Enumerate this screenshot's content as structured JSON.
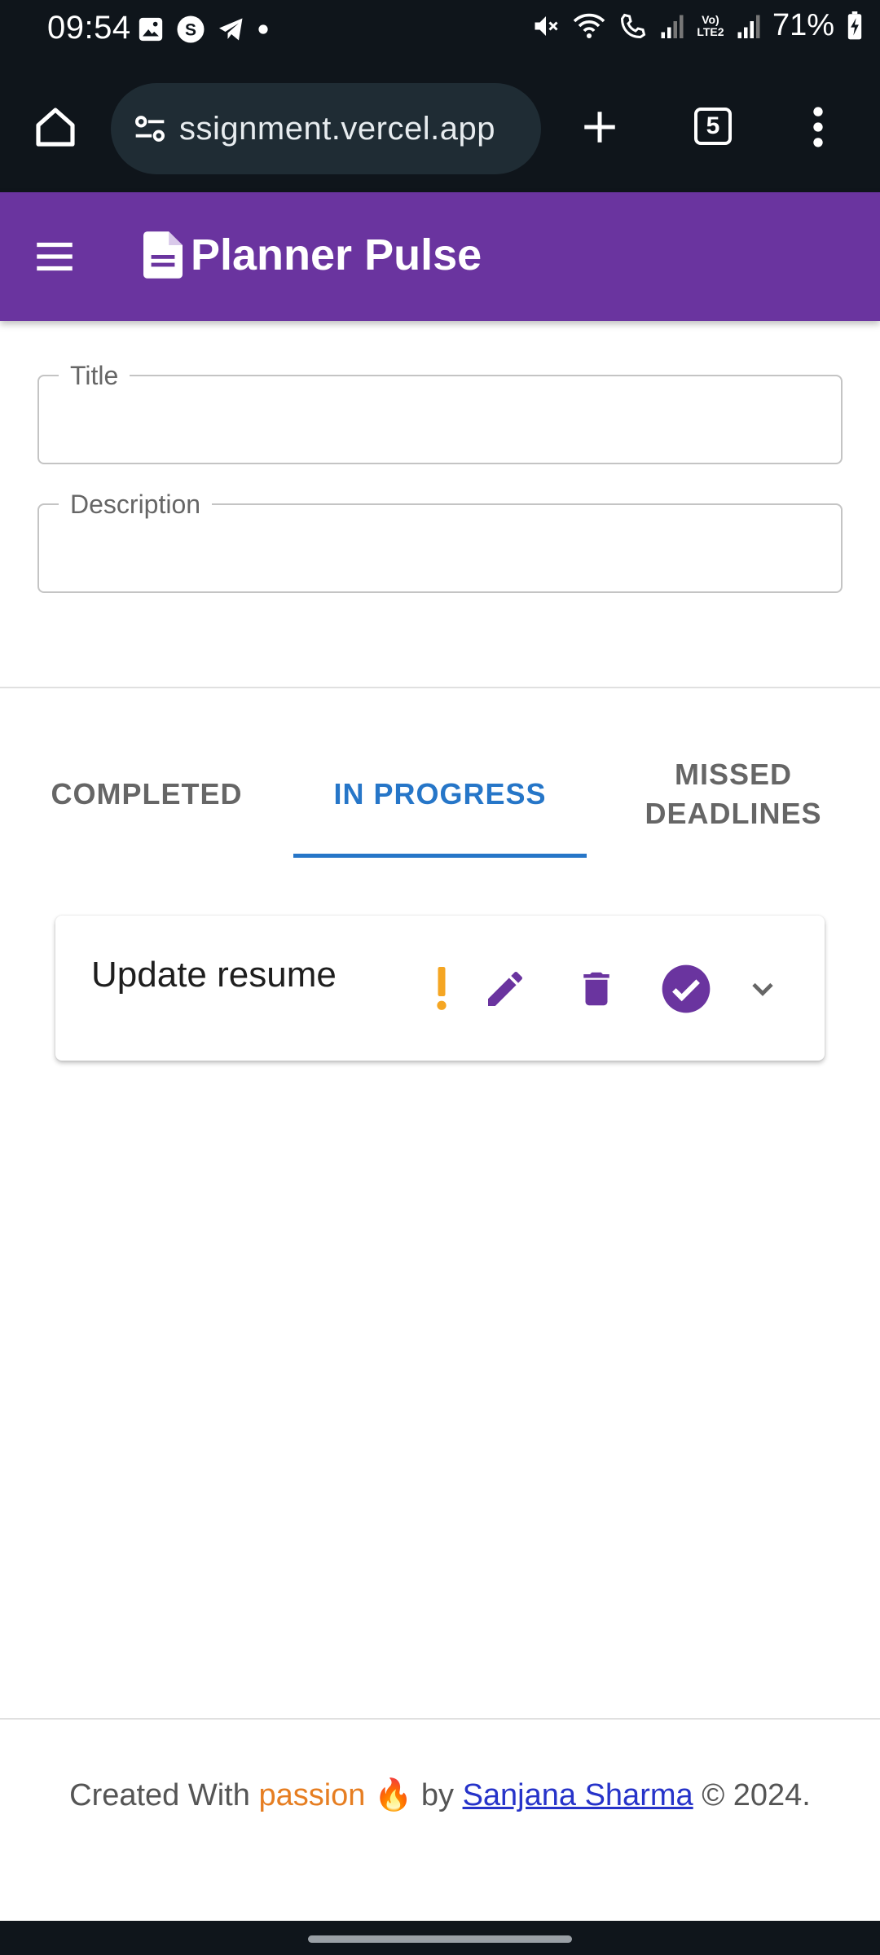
{
  "status_bar": {
    "time": "09:54",
    "battery": "71%",
    "network_label": "Vo) LTE2"
  },
  "browser": {
    "url": "ssignment.vercel.app",
    "tab_count": "5"
  },
  "app": {
    "title": "Planner Pulse",
    "accent_color": "#6a349f"
  },
  "form": {
    "title_label": "Title",
    "title_value": "",
    "description_label": "Description",
    "description_value": ""
  },
  "tabs": [
    {
      "label": "COMPLETED",
      "active": false
    },
    {
      "label": "IN PROGRESS",
      "active": true
    },
    {
      "label": "MISSED DEADLINES",
      "active": false
    }
  ],
  "tasks": [
    {
      "title": "Update resume",
      "icons": [
        "priority-icon",
        "edit-icon",
        "delete-icon",
        "complete-icon",
        "expand-icon"
      ]
    }
  ],
  "footer": {
    "prefix": "Created With ",
    "passion": "passion",
    "fire": "🔥",
    "by": " by ",
    "author": "Sanjana Sharma",
    "suffix": " © 2024."
  }
}
